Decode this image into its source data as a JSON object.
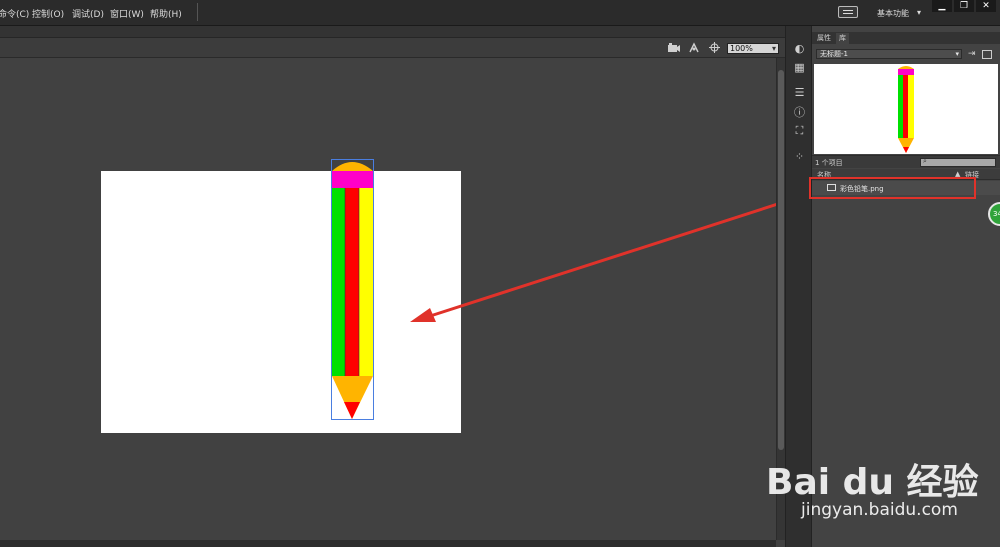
{
  "menu": {
    "items": [
      "命令(C)",
      "控制(O)",
      "调试(D)",
      "窗口(W)",
      "帮助(H)"
    ]
  },
  "workspace": {
    "label": "基本功能",
    "arrow": "▾"
  },
  "window": {
    "minimize": "▁",
    "restore": "❐",
    "close": "✕"
  },
  "toolbar": {
    "zoom": "100%"
  },
  "panel": {
    "tabs": [
      "属性",
      "库"
    ],
    "document": "无标题-1",
    "item_count": "1 个项目",
    "col_name": "名称",
    "col_link": "链接",
    "library_item": "彩色铅笔.png"
  },
  "badge": "34",
  "watermark": {
    "logo": "Bai du 经验",
    "url": "jingyan.baidu.com"
  },
  "colors": {
    "pencil_tip": "#ffb400",
    "pencil_eraser": "#ff00c8",
    "pencil_green": "#00e000",
    "pencil_red": "#ff0000",
    "pencil_yellow": "#ffff00",
    "arrow": "#e0322a",
    "selection": "#4a7ee0"
  },
  "icons": [
    "palette-icon",
    "grid-icon",
    "align-icon",
    "info-icon",
    "transform-icon",
    "motion-icon",
    "camera-icon",
    "rotate-icon",
    "center-icon",
    "search-icon",
    "pin-icon",
    "image-icon"
  ]
}
